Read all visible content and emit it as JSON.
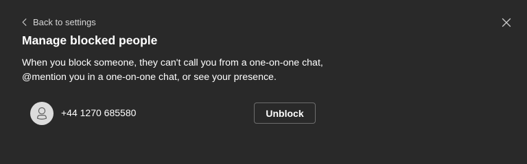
{
  "header": {
    "back_label": "Back to settings",
    "back_icon": "chevron-left-icon",
    "close_icon": "close-icon"
  },
  "page": {
    "title": "Manage blocked people",
    "description_line1": "When you block someone, they can't call you from a one-on-one chat,",
    "description_line2": "@mention you in a one-on-one chat, or see your presence."
  },
  "blocked": {
    "items": [
      {
        "avatar_icon": "person-icon",
        "phone": "+44 1270 685580",
        "action_label": "Unblock"
      }
    ]
  },
  "colors": {
    "background": "#292929",
    "text_primary": "#ffffff",
    "text_secondary": "#d6d6d6",
    "button_border": "#6e6e6e",
    "avatar_background": "#dcdcdc"
  }
}
